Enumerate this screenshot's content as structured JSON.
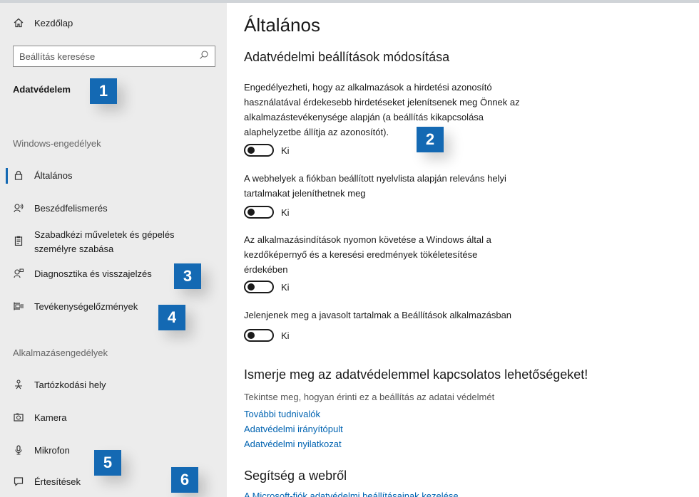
{
  "sidebar": {
    "home_label": "Kezdőlap",
    "search_placeholder": "Beállítás keresése",
    "category": "Adatvédelem",
    "windows_permissions_label": "Windows-engedélyek",
    "windows_items": [
      {
        "label": "Általános",
        "icon": "lock-icon"
      },
      {
        "label": "Beszédfelismerés",
        "icon": "speech-icon"
      },
      {
        "label_line1": "Szabadkézi műveletek és gépelés",
        "label_line2": "személyre szabása",
        "icon": "clipboard-icon"
      },
      {
        "label": "Diagnosztika és visszajelzés",
        "icon": "feedback-icon"
      },
      {
        "label": "Tevékenységelőzmények",
        "icon": "timeline-icon"
      }
    ],
    "app_permissions_label": "Alkalmazásengedélyek",
    "app_items": [
      {
        "label": "Tartózkodási hely",
        "icon": "location-icon"
      },
      {
        "label": "Kamera",
        "icon": "camera-icon"
      },
      {
        "label": "Mikrofon",
        "icon": "microphone-icon"
      },
      {
        "label": "Értesítések",
        "icon": "notification-icon"
      }
    ]
  },
  "main": {
    "title": "Általános",
    "subtitle": "Adatvédelmi beállítások módosítása",
    "settings": [
      {
        "description_lines": [
          "Engedélyezheti, hogy az alkalmazások a hirdetési azonosító",
          "használatával érdekesebb hirdetéseket jelenítsenek meg Önnek az",
          "alkalmazástevékenysége alapján (a beállítás kikapcsolása",
          "alaphelyzetbe állítja az azonosítót)."
        ],
        "state": "Ki"
      },
      {
        "description_lines": [
          "A webhelyek a fiókban beállított nyelvlista alapján releváns helyi",
          "tartalmakat jeleníthetnek meg"
        ],
        "state": "Ki"
      },
      {
        "description_lines": [
          "Az alkalmazásindítások nyomon követése a Windows által a",
          "kezdőképernyő és a keresési eredmények tökéletesítése",
          "érdekében"
        ],
        "state": "Ki"
      },
      {
        "description_lines": [
          "Jelenjenek meg a javasolt tartalmak a Beállítások alkalmazásban"
        ],
        "state": "Ki"
      }
    ],
    "learn_heading": "Ismerje meg az adatvédelemmel kapcsolatos lehetőségeket!",
    "learn_text": "Tekintse meg, hogyan érinti ez a beállítás az adatai védelmét",
    "links": [
      "További tudnivalók",
      "Adatvédelmi irányítópult",
      "Adatvédelmi nyilatkozat"
    ],
    "web_help_heading": "Segítség a webről",
    "web_help_link": "A Microsoft-fiók adatvédelmi beállításainak kezelése"
  },
  "badges": [
    "1",
    "2",
    "3",
    "4",
    "5",
    "6"
  ],
  "colors": {
    "accent": "#1469b3",
    "link": "#0063b1",
    "sidebar_bg": "#ececec"
  }
}
